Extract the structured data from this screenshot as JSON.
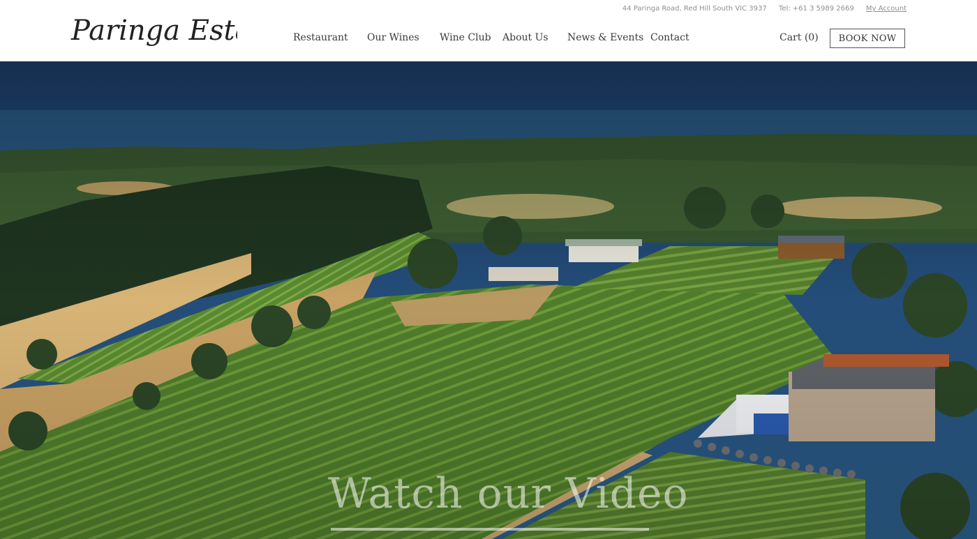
{
  "brand": {
    "name": "Paringa Estate"
  },
  "topbar": {
    "address": "44 Paringa Road, Red Hill South VIC 3937",
    "phone": "Tel: +61 3 5989 2669",
    "account": "My Account"
  },
  "nav": {
    "items": [
      "Restaurant",
      "Our Wines",
      "Wine Club",
      "About Us",
      "News & Events",
      "Contact"
    ]
  },
  "header": {
    "cart": "Cart (0)",
    "book": "BOOK NOW"
  },
  "hero": {
    "video_title": "Watch our Video"
  },
  "colors": {
    "sky": "#1f4a78",
    "sea": "#2d5f86",
    "vine": "#4d7a2a",
    "field": "#c9a56a"
  }
}
